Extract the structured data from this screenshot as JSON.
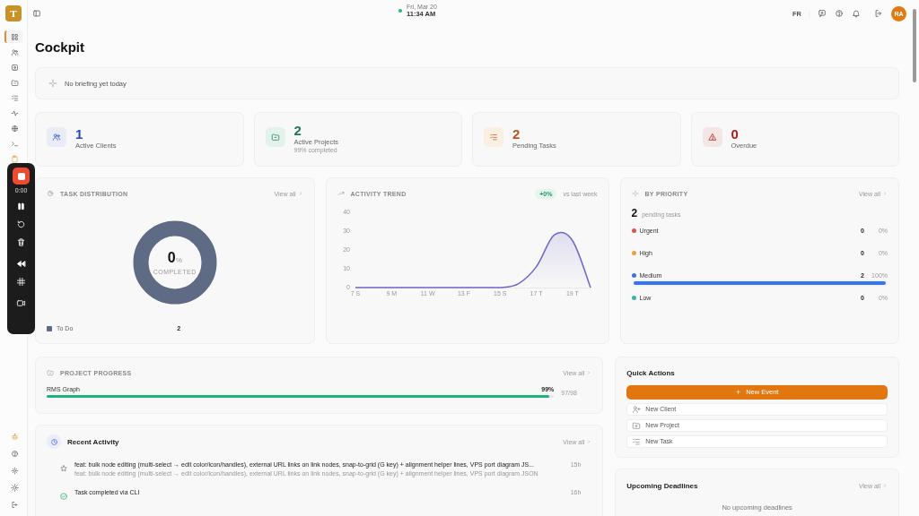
{
  "app": {
    "logo": "T"
  },
  "header": {
    "date": "Fri, Mar 20",
    "time": "11:34 AM",
    "online": true,
    "language": "FR",
    "avatar": "RA"
  },
  "sidebar": {
    "items": [
      {
        "selected": true
      },
      {
        "selected": false
      },
      {
        "selected": false
      },
      {
        "selected": false
      },
      {
        "selected": false
      },
      {
        "selected": false
      },
      {
        "selected": false
      },
      {
        "selected": false
      },
      {
        "selected": false
      }
    ]
  },
  "recorder": {
    "time": "0:00"
  },
  "page": {
    "title": "Cockpit"
  },
  "briefing": {
    "text": "No briefing yet today"
  },
  "stats": [
    {
      "value": "1",
      "label": "Active Clients",
      "color": "#2447c9"
    },
    {
      "value": "2",
      "label": "Active Projects",
      "sub": "99% completed",
      "color": "#1f7a55"
    },
    {
      "value": "2",
      "label": "Pending Tasks",
      "color": "#b8561a"
    },
    {
      "value": "0",
      "label": "Overdue",
      "color": "#a81e1e"
    }
  ],
  "task_distribution": {
    "title": "TASK DISTRIBUTION",
    "link": "View all",
    "center_value": "0",
    "center_unit": "%",
    "center_label": "COMPLETED",
    "legend": [
      {
        "label": "To Do",
        "count": "2",
        "color": "#5f6b85"
      }
    ]
  },
  "activity_trend": {
    "title": "ACTIVITY TREND",
    "change": "+0%",
    "compare": "vs last week",
    "chart_data": {
      "type": "area",
      "x": [
        7,
        8,
        9,
        10,
        11,
        12,
        13,
        14,
        15,
        16,
        17,
        18,
        19,
        20
      ],
      "xticks": [
        {
          "value": 7,
          "label": "7 S"
        },
        {
          "value": 9,
          "label": "9 M"
        },
        {
          "value": 11,
          "label": "11 W"
        },
        {
          "value": 13,
          "label": "13 F"
        },
        {
          "value": 15,
          "label": "15 S"
        },
        {
          "value": 17,
          "label": "17 T"
        },
        {
          "value": 19,
          "label": "19 T"
        }
      ],
      "yticks": [
        0,
        10,
        20,
        30,
        40
      ],
      "xlim": [
        7,
        20
      ],
      "ylim": [
        0,
        40
      ],
      "series": [
        {
          "color": "#6d66c9",
          "values": [
            0,
            0,
            0,
            0,
            0,
            0,
            0,
            0,
            0,
            2,
            11,
            28,
            25,
            0
          ]
        }
      ]
    }
  },
  "by_priority": {
    "title": "BY PRIORITY",
    "link": "View all",
    "total": "2",
    "total_label": "pending tasks",
    "rows": [
      {
        "name": "Urgent",
        "color": "#d9534f",
        "count": "0",
        "percent": "0%"
      },
      {
        "name": "High",
        "color": "#e8a23c",
        "count": "0",
        "percent": "0%"
      },
      {
        "name": "Medium",
        "color": "#3b74e0",
        "count": "2",
        "percent": "100%",
        "level": 1
      },
      {
        "name": "Low",
        "color": "#3fb3a8",
        "count": "0",
        "percent": "0%"
      }
    ]
  },
  "project_progress": {
    "title": "PROJECT PROGRESS",
    "link": "View all",
    "projects": [
      {
        "name": "RMS Graph",
        "percent": "99%",
        "tasks": "97/98",
        "level": 0.99
      }
    ]
  },
  "recent_activity": {
    "title": "Recent Activity",
    "link": "View all",
    "items": [
      {
        "kind": "commit",
        "title": "feat: bulk node editing (multi-select → edit color/icon/handles), external URL links on link nodes, snap-to-grid (G key) + alignment helper lines, VPS port diagram JS...",
        "detail": "feat: bulk node editing (multi-select → edit color/icon/handles), external URL links on link nodes, snap-to-grid (G key) + alignment helper lines, VPS port diagram JSON",
        "time": "15h"
      },
      {
        "kind": "task",
        "title": "Task completed via CLI",
        "time": "16h"
      }
    ]
  },
  "quick_actions": {
    "title": "Quick Actions",
    "primary_icon": "+",
    "primary": "New Event",
    "actions": [
      "New Client",
      "New Project",
      "New Task"
    ]
  },
  "upcoming_deadlines": {
    "title": "Upcoming Deadlines",
    "link": "View all",
    "empty": "No upcoming deadlines"
  }
}
